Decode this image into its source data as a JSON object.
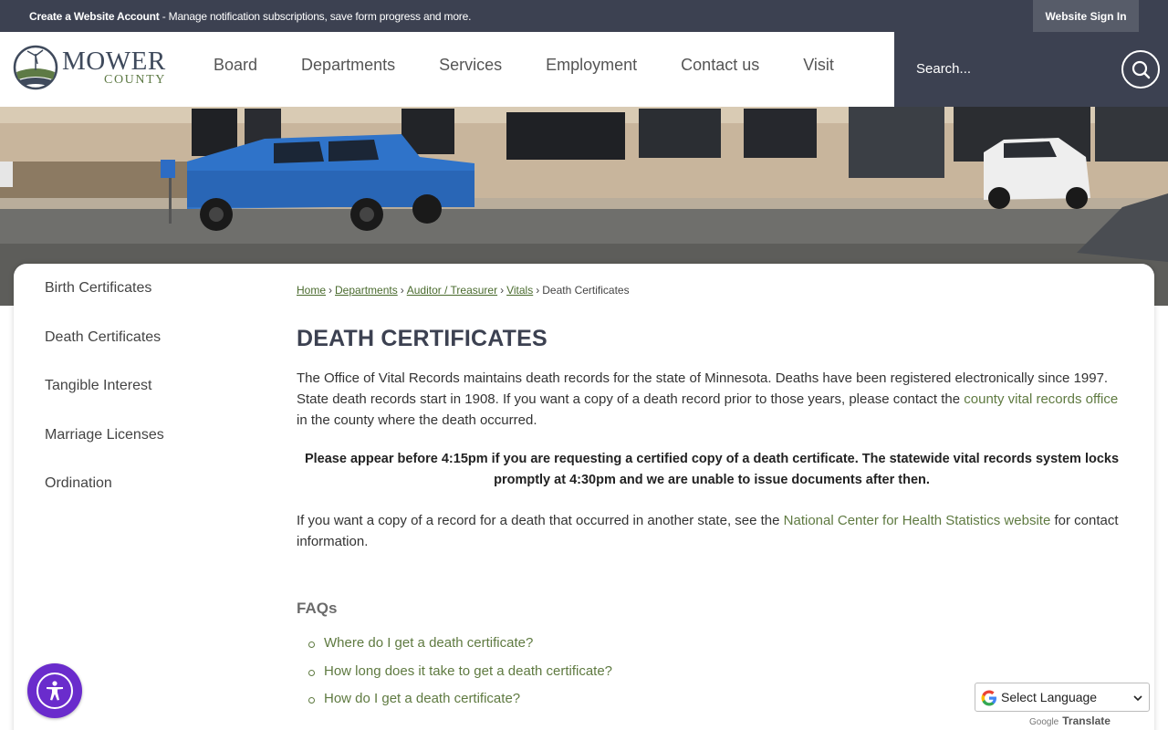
{
  "topbar": {
    "create_account_bold": "Create a Website Account",
    "create_account_text": " - Manage notification subscriptions, save form progress and more.",
    "sign_in": "Website Sign In"
  },
  "logo": {
    "word1": "MOWER",
    "word2": "COUNTY"
  },
  "nav": [
    "Board",
    "Departments",
    "Services",
    "Employment",
    "Contact us",
    "Visit"
  ],
  "search": {
    "placeholder": "Search..."
  },
  "sidebar": [
    "Birth Certificates",
    "Death Certificates",
    "Tangible Interest",
    "Marriage Licenses",
    "Ordination"
  ],
  "breadcrumb": {
    "links": [
      "Home",
      "Departments",
      "Auditor / Treasurer",
      "Vitals"
    ],
    "separator": "›",
    "current": "Death Certificates"
  },
  "page": {
    "title": "DEATH CERTIFICATES",
    "intro_text": "The Office of Vital Records maintains death records for the state of Minnesota. Deaths have been registered electronically since 1997. State death records start in 1908. If you want a copy of a death record prior to those years, please contact the ",
    "intro_link": "county vital records office",
    "intro_tail": " in the county where the death occurred.",
    "notice": "Please appear before 4:15pm if you are requesting a certified copy of a death certificate. The statewide vital records system locks promptly at 4:30pm and we are unable to issue documents after then.",
    "other_state_text": "If you want a copy of a record for a death that occurred in another state, see the ",
    "other_state_link": "National Center for Health Statistics website",
    "other_state_tail": " for contact information.",
    "faqs_heading": "FAQs",
    "faqs": [
      "Where do I get a death certificate?",
      "How long does it take to get a death certificate?",
      "How do I get a death certificate?"
    ]
  },
  "translate": {
    "select_label": "Select Language",
    "powered_google": "Google",
    "powered_translate": "Translate"
  },
  "colors": {
    "dark_bar": "#3c4151",
    "link_green": "#5f7a41",
    "accessibility_purple": "#6a2ccc"
  }
}
